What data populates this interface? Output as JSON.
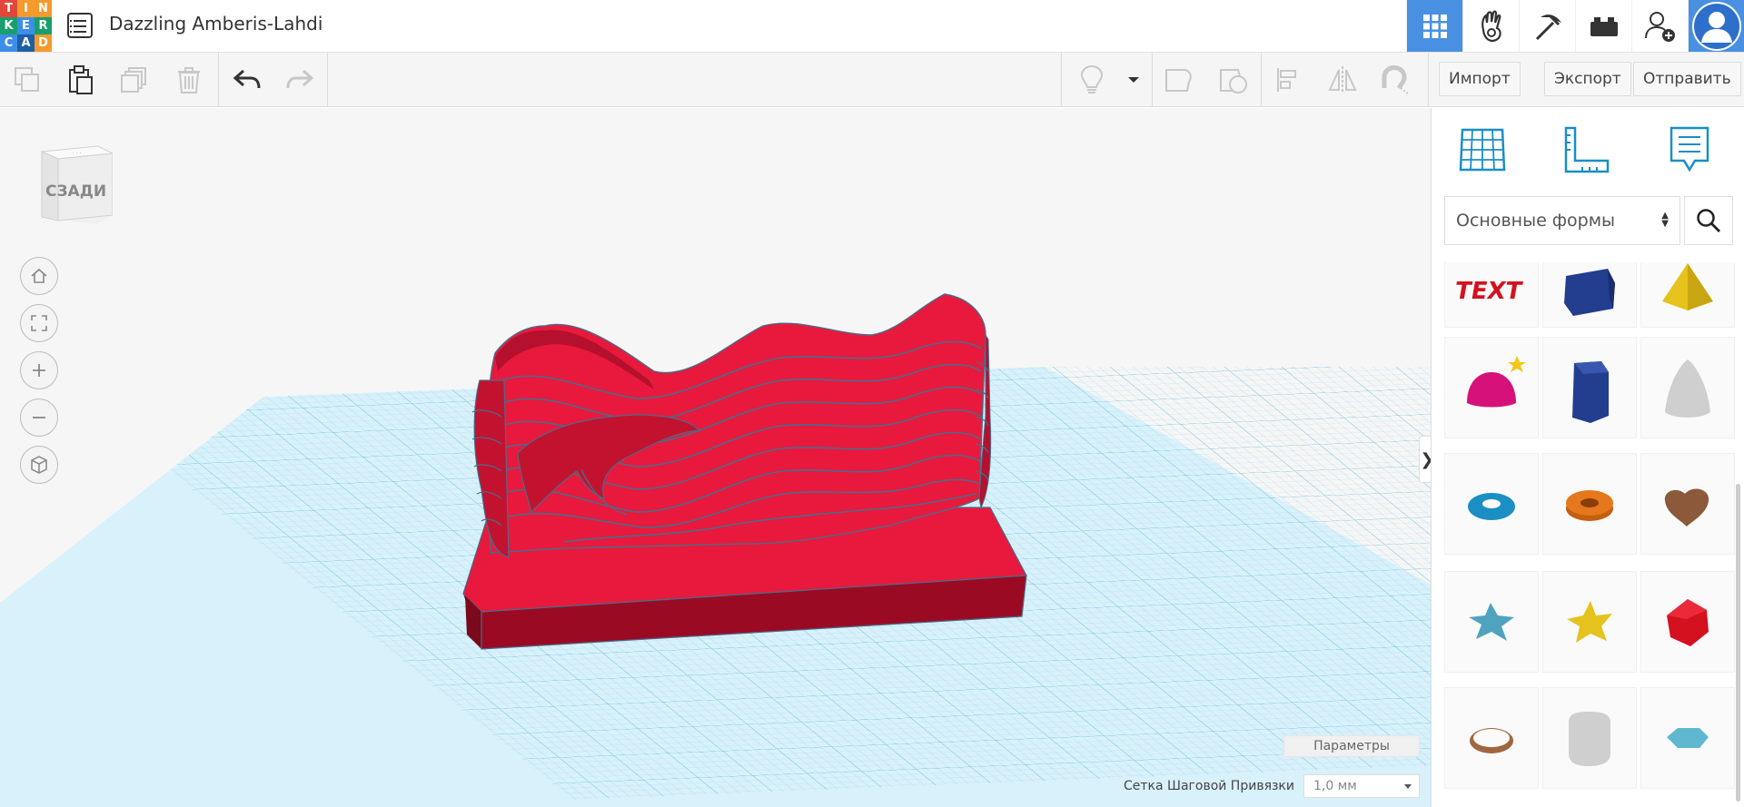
{
  "app": {
    "logo_letters": [
      "T",
      "I",
      "N",
      "K",
      "E",
      "R",
      "C",
      "A",
      "D"
    ],
    "logo_colors": [
      "#e2463a",
      "#f59a2d",
      "#f59a2d",
      "#17a06b",
      "#3c8ee8",
      "#17a06b",
      "#3c8ee8",
      "#1c5fa8",
      "#f59a2d"
    ],
    "project_title": "Dazzling Amberis-Lahdi"
  },
  "topnav": {
    "items": [
      "grid-view-icon",
      "tinker-hand-icon",
      "pickaxe-icon",
      "brick-icon",
      "add-user-icon",
      "avatar"
    ]
  },
  "toolbar": {
    "left": [
      "copy-icon",
      "paste-icon",
      "duplicate-icon",
      "delete-icon",
      "undo-icon",
      "redo-icon"
    ],
    "right_icons": [
      "light-bulb-icon",
      "dropdown-arrow-icon",
      "shape-icon",
      "hole-icon",
      "align-icon",
      "mirror-icon",
      "magnet-icon"
    ],
    "import_label": "Импорт",
    "export_label": "Экспорт",
    "send_label": "Отправить"
  },
  "viewport": {
    "viewcube_label": "СЗАДИ",
    "nav": [
      "home-icon",
      "fit-icon",
      "zoom-in-icon",
      "zoom-out-icon",
      "ortho-icon"
    ],
    "params_label": "Параметры",
    "snap_label": "Сетка Шаговой Привязки",
    "snap_value": "1,0 мм",
    "model_color": "#e8193c",
    "grid_color": "#7fcbe3"
  },
  "panel": {
    "tool_icons": [
      "workplane-icon",
      "ruler-icon",
      "notes-icon"
    ],
    "shape_category": "Основные формы",
    "shapes": [
      {
        "name": "text-shape",
        "color": "#d4111f"
      },
      {
        "name": "box-shape",
        "color": "#233d8f"
      },
      {
        "name": "pyramid-shape",
        "color": "#e6c21c"
      },
      {
        "name": "half-sphere-shape",
        "color": "#d6117a"
      },
      {
        "name": "polygon-shape",
        "color": "#233d8f"
      },
      {
        "name": "paraboloid-shape",
        "color": "#cfcfcf"
      },
      {
        "name": "torus-shape",
        "color": "#1b8fc4"
      },
      {
        "name": "tube-shape",
        "color": "#e5781c"
      },
      {
        "name": "heart-shape",
        "color": "#8c5a3a"
      },
      {
        "name": "star-shape",
        "color": "#4fa3bf"
      },
      {
        "name": "star-yellow-shape",
        "color": "#e6c21c"
      },
      {
        "name": "icosahedron-shape",
        "color": "#d4111f"
      },
      {
        "name": "ring-shape",
        "color": "#a0673e"
      },
      {
        "name": "rounded-cube-shape",
        "color": "#cfcfcf"
      },
      {
        "name": "diamond-shape",
        "color": "#5fb8cf"
      }
    ]
  }
}
